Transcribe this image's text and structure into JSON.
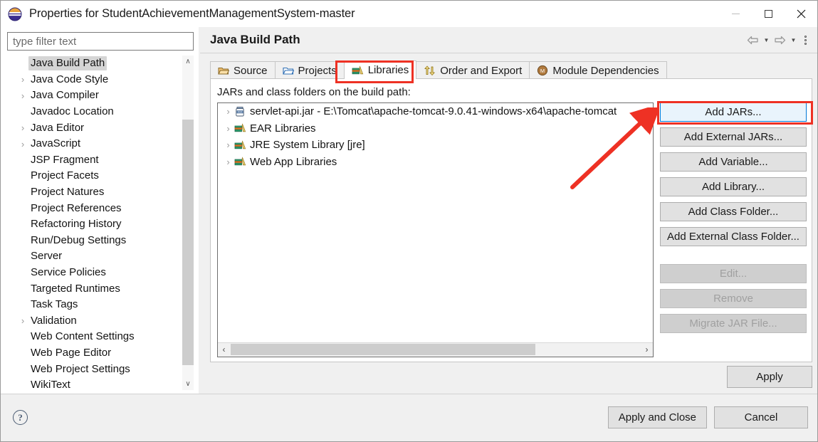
{
  "window": {
    "title": "Properties for StudentAchievementManagementSystem-master",
    "logo_icon": "eclipse-logo-icon",
    "minimize_label": "Minimize",
    "maximize_label": "Maximize",
    "close_label": "Close",
    "close_glyph": "✕"
  },
  "sidebar": {
    "filter_placeholder": "type filter text",
    "filter_value": "",
    "items": [
      {
        "label": "Java Build Path",
        "expandable": false,
        "selected": true
      },
      {
        "label": "Java Code Style",
        "expandable": true,
        "selected": false
      },
      {
        "label": "Java Compiler",
        "expandable": true,
        "selected": false
      },
      {
        "label": "Javadoc Location",
        "expandable": false,
        "selected": false
      },
      {
        "label": "Java Editor",
        "expandable": true,
        "selected": false
      },
      {
        "label": "JavaScript",
        "expandable": true,
        "selected": false
      },
      {
        "label": "JSP Fragment",
        "expandable": false,
        "selected": false
      },
      {
        "label": "Project Facets",
        "expandable": false,
        "selected": false
      },
      {
        "label": "Project Natures",
        "expandable": false,
        "selected": false
      },
      {
        "label": "Project References",
        "expandable": false,
        "selected": false
      },
      {
        "label": "Refactoring History",
        "expandable": false,
        "selected": false
      },
      {
        "label": "Run/Debug Settings",
        "expandable": false,
        "selected": false
      },
      {
        "label": "Server",
        "expandable": false,
        "selected": false
      },
      {
        "label": "Service Policies",
        "expandable": false,
        "selected": false
      },
      {
        "label": "Targeted Runtimes",
        "expandable": false,
        "selected": false
      },
      {
        "label": "Task Tags",
        "expandable": false,
        "selected": false
      },
      {
        "label": "Validation",
        "expandable": true,
        "selected": false
      },
      {
        "label": "Web Content Settings",
        "expandable": false,
        "selected": false
      },
      {
        "label": "Web Page Editor",
        "expandable": false,
        "selected": false
      },
      {
        "label": "Web Project Settings",
        "expandable": false,
        "selected": false
      },
      {
        "label": "WikiText",
        "expandable": false,
        "selected": false
      }
    ],
    "scroll_up_glyph": "∧",
    "scroll_down_glyph": "∨"
  },
  "page": {
    "title": "Java Build Path",
    "nav": {
      "back_icon": "back-arrow-icon",
      "back_caret_glyph": "▼",
      "forward_icon": "forward-arrow-icon",
      "forward_caret_glyph": "▼",
      "menu_icon": "vertical-dots-menu-icon"
    }
  },
  "tabs": [
    {
      "label": "Source",
      "icon": "source-folder-icon",
      "active": false
    },
    {
      "label": "Projects",
      "icon": "projects-folder-icon",
      "active": false
    },
    {
      "label": "Libraries",
      "icon": "libraries-books-icon",
      "active": true
    },
    {
      "label": "Order and Export",
      "icon": "order-export-arrows-icon",
      "active": false
    },
    {
      "label": "Module Dependencies",
      "icon": "module-badge-icon",
      "active": false
    }
  ],
  "libraries_panel": {
    "section_label": "JARs and class folders on the build path:",
    "entries": [
      {
        "label": "servlet-api.jar - E:\\Tomcat\\apache-tomcat-9.0.41-windows-x64\\apache-tomcat",
        "icon": "jar-file-icon"
      },
      {
        "label": "EAR Libraries",
        "icon": "library-books-icon"
      },
      {
        "label": "JRE System Library [jre]",
        "icon": "library-books-icon"
      },
      {
        "label": "Web App Libraries",
        "icon": "library-books-icon"
      }
    ],
    "hscroll_left_glyph": "‹",
    "hscroll_right_glyph": "›",
    "buttons": [
      {
        "label": "Add JARs...",
        "state": "focused"
      },
      {
        "label": "Add External JARs...",
        "state": "enabled"
      },
      {
        "label": "Add Variable...",
        "state": "enabled"
      },
      {
        "label": "Add Library...",
        "state": "enabled"
      },
      {
        "label": "Add Class Folder...",
        "state": "enabled"
      },
      {
        "label": "Add External Class Folder...",
        "state": "enabled"
      },
      {
        "label": "Edit...",
        "state": "disabled"
      },
      {
        "label": "Remove",
        "state": "disabled"
      },
      {
        "label": "Migrate JAR File...",
        "state": "disabled"
      }
    ],
    "apply_label": "Apply"
  },
  "footer": {
    "help_icon": "help-question-icon",
    "help_glyph": "?",
    "apply_and_close_label": "Apply and Close",
    "cancel_label": "Cancel"
  },
  "annotations": {
    "highlight_color": "#ee3124",
    "targets": [
      "libraries-tab",
      "add-jars-button"
    ],
    "arrow_icon": "red-pointer-arrow-icon"
  }
}
